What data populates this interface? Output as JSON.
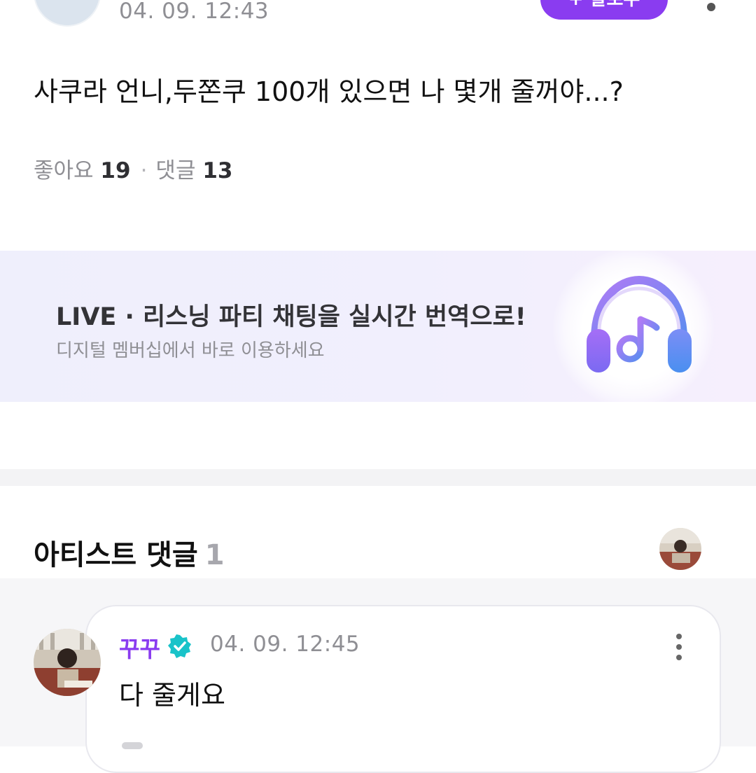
{
  "post": {
    "time": "04. 09. 12:43",
    "follow_label": "+ 팔로우",
    "body": "사쿠라 언니,두쫀쿠 100개 있으면 나 몇개 줄꺼야...?",
    "likes_label": "좋아요",
    "likes_count": "19",
    "separator": "·",
    "comments_label": "댓글",
    "comments_count": "13"
  },
  "banner": {
    "title": "LIVE · 리스닝 파티 채팅을 실시간 번역으로!",
    "subtitle": "디지털 멤버십에서 바로 이용하세요",
    "icon": "headphones-music-icon"
  },
  "artist_comments": {
    "title": "아티스트 댓글",
    "count": "1",
    "items": [
      {
        "author": "꾸꾸",
        "verified": true,
        "time": "04. 09. 12:45",
        "text": "다 줄게요"
      }
    ]
  },
  "colors": {
    "accent": "#8a3cf0",
    "verified": "#19c3c9",
    "muted_text": "#8f8f94",
    "banner_bg": "#efeffc"
  }
}
